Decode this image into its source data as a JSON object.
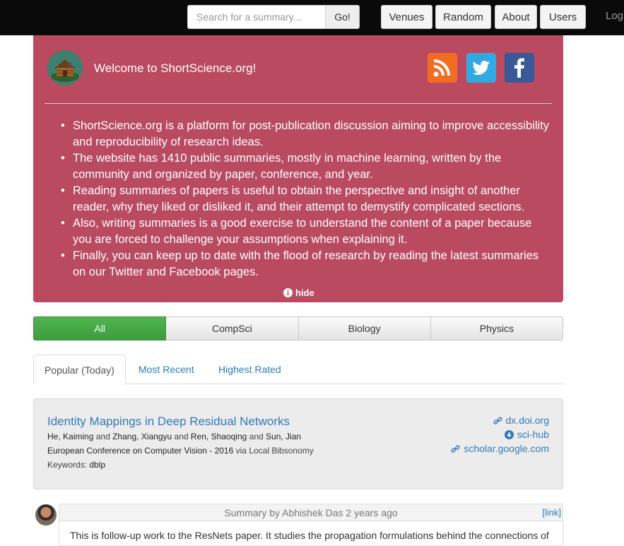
{
  "nav": {
    "search_placeholder": "Search for a summary...",
    "search_button": "Go!",
    "buttons": [
      "Venues",
      "Random",
      "About",
      "Users"
    ],
    "login": "Login"
  },
  "welcome": {
    "title": "Welcome to ShortScience.org!",
    "bullets": [
      "ShortScience.org is a platform for post-publication discussion aiming to improve accessibility and reproducibility of research ideas.",
      "The website has 1410 public summaries, mostly in machine learning, written by the community and organized by paper, conference, and year.",
      "Reading summaries of papers is useful to obtain the perspective and insight of another reader, why they liked or disliked it, and their attempt to demystify complicated sections.",
      "Also, writing summaries is a good exercise to understand the content of a paper because you are forced to challenge your assumptions when explaining it.",
      "Finally, you can keep up to date with the flood of research by reading the latest summaries on our Twitter and Facebook pages."
    ],
    "hide_label": "hide",
    "icons": [
      "cabin-logo-icon",
      "rss-icon",
      "twitter-icon",
      "facebook-icon",
      "info-circle-icon"
    ]
  },
  "categories": {
    "items": [
      "All",
      "CompSci",
      "Biology",
      "Physics"
    ],
    "active": "All",
    "active_color": "#46a846"
  },
  "sort_tabs": {
    "items": [
      "Popular (Today)",
      "Most Recent",
      "Highest Rated"
    ],
    "active": "Popular (Today)"
  },
  "paper": {
    "title": "Identity Mappings in Deep Residual Networks",
    "authors": [
      {
        "last": "He",
        "first": "Kaiming"
      },
      {
        "last": "Zhang",
        "first": "Xiangyu"
      },
      {
        "last": "Ren",
        "first": "Shaoqing"
      },
      {
        "last": "Sun",
        "first": "Jian"
      }
    ],
    "author_separator": "and",
    "venue": "European Conference on Computer Vision - 2016",
    "via_label": "via",
    "source": "Local Bibsonomy",
    "keywords_label": "Keywords:",
    "keywords": "dblp",
    "links": {
      "doi": "dx.doi.org",
      "scihub": "sci-hub",
      "scholar": "scholar.google.com"
    }
  },
  "summary": {
    "byline": "Summary by Abhishek Das 2 years ago",
    "link_label": "[link]",
    "excerpt": "This is follow-up work to the ResNets paper. It studies the propagation formulations behind the connections of"
  }
}
